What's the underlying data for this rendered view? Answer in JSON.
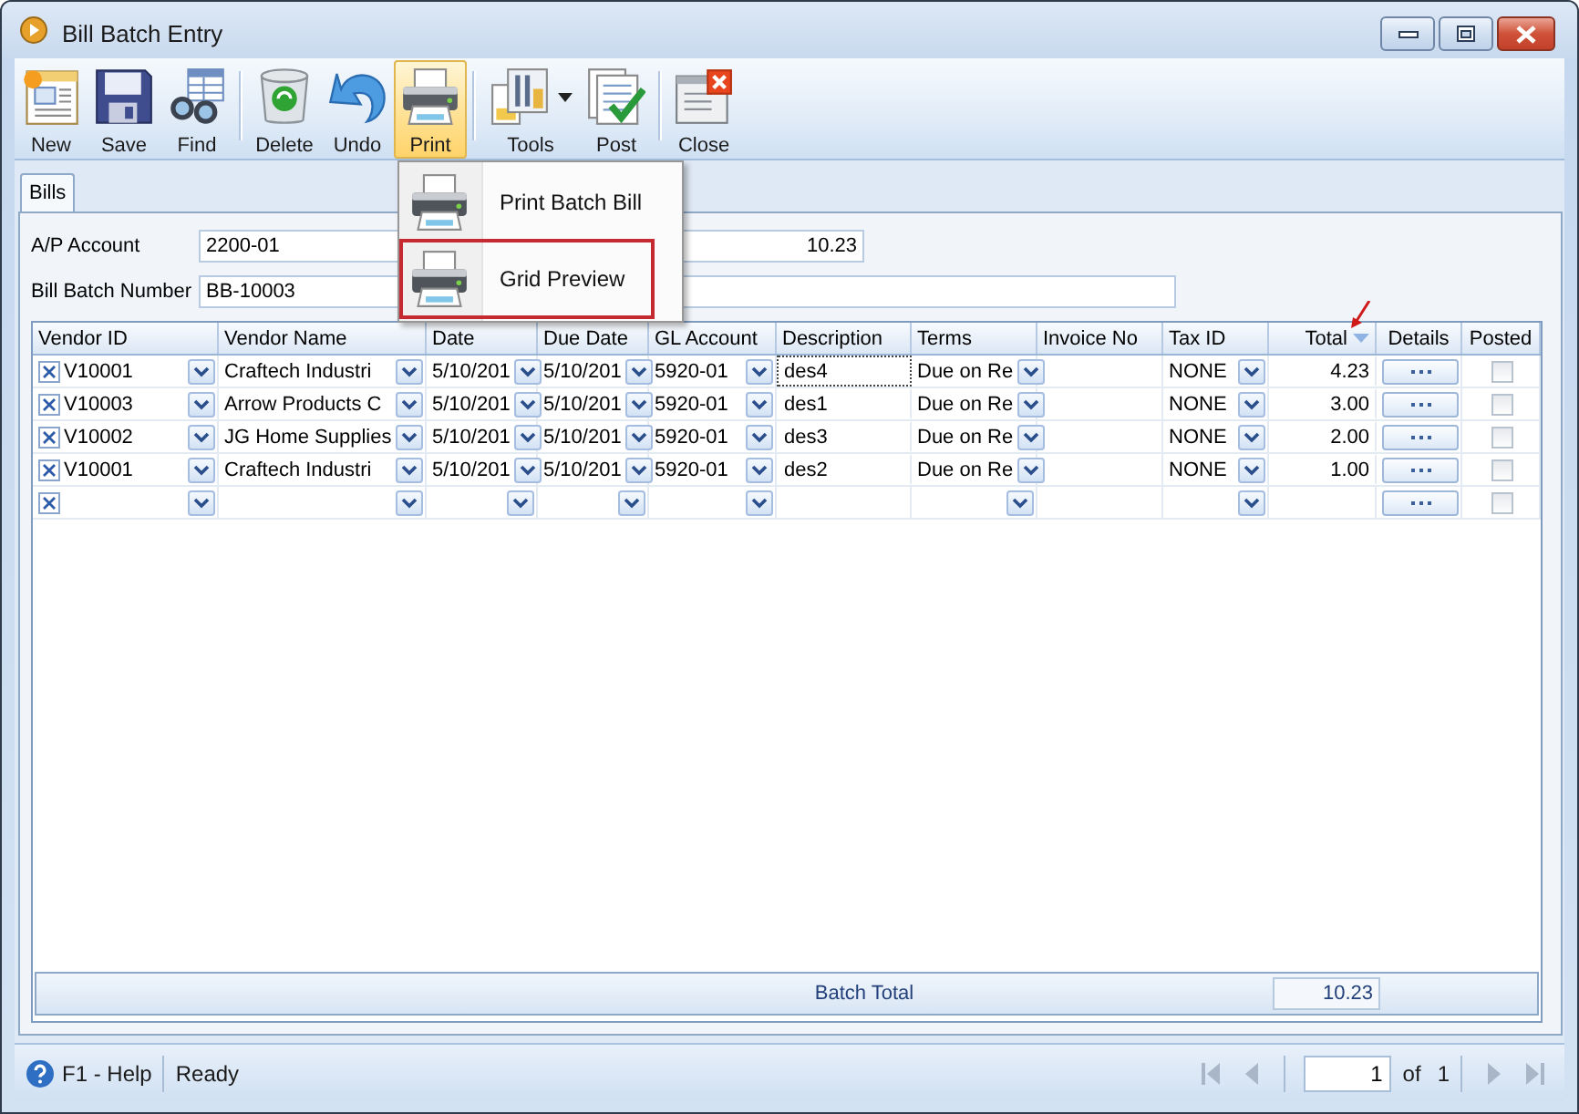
{
  "window": {
    "title": "Bill Batch Entry"
  },
  "toolbar": {
    "groups": [
      [
        {
          "label": "New",
          "kind": "new",
          "pressed": false,
          "has_menu": false
        },
        {
          "label": "Save",
          "kind": "save",
          "pressed": false,
          "has_menu": false
        },
        {
          "label": "Find",
          "kind": "find",
          "pressed": false,
          "has_menu": false
        }
      ],
      [
        {
          "label": "Delete",
          "kind": "delete",
          "pressed": false,
          "has_menu": false
        },
        {
          "label": "Undo",
          "kind": "undo",
          "pressed": false,
          "has_menu": false
        },
        {
          "label": "Print",
          "kind": "print",
          "pressed": true,
          "has_menu": false
        }
      ],
      [
        {
          "label": "Tools",
          "kind": "tools",
          "pressed": false,
          "has_menu": true
        },
        {
          "label": "Post",
          "kind": "post",
          "pressed": false,
          "has_menu": false
        }
      ],
      [
        {
          "label": "Close",
          "kind": "close",
          "pressed": false,
          "has_menu": false
        }
      ]
    ]
  },
  "print_menu": {
    "items": [
      {
        "label": "Print Batch Bill",
        "outlined": false
      },
      {
        "label": "Grid Preview",
        "outlined": true
      }
    ]
  },
  "tabs": [
    {
      "label": "Bills",
      "selected": true
    }
  ],
  "form": {
    "rows": [
      {
        "label": "A/P Account",
        "fields": [
          {
            "value": "2200-01",
            "kind": "text"
          },
          {
            "value": "10.23",
            "kind": "number"
          }
        ]
      },
      {
        "label": "Bill Batch Number",
        "fields": [
          {
            "value": "BB-10003",
            "kind": "text"
          }
        ]
      }
    ]
  },
  "table": {
    "columns": [
      {
        "label": "Vendor ID",
        "kind": "combo",
        "sorted": false,
        "callout": false
      },
      {
        "label": "Vendor Name",
        "kind": "combo",
        "sorted": false,
        "callout": false
      },
      {
        "label": "Date",
        "kind": "combo",
        "sorted": false,
        "callout": false
      },
      {
        "label": "Due Date",
        "kind": "combo",
        "sorted": false,
        "callout": false
      },
      {
        "label": "GL Account",
        "kind": "combo",
        "sorted": false,
        "callout": false
      },
      {
        "label": "Description",
        "kind": "text",
        "sorted": false,
        "callout": false
      },
      {
        "label": "Terms",
        "kind": "combo",
        "sorted": false,
        "callout": false
      },
      {
        "label": "Invoice No",
        "kind": "text",
        "sorted": false,
        "callout": false
      },
      {
        "label": "Tax ID",
        "kind": "combo",
        "sorted": false,
        "callout": false
      },
      {
        "label": "Total",
        "kind": "number",
        "sorted": true,
        "callout": true
      },
      {
        "label": "Details",
        "kind": "button",
        "sorted": false,
        "callout": false
      },
      {
        "label": "Posted",
        "kind": "check",
        "sorted": false,
        "callout": false
      }
    ],
    "rows": [
      {
        "current": true,
        "vendor_id": "V10001",
        "vendor_name": "Craftech Industri",
        "date": "5/10/201",
        "due_date": "5/10/201",
        "gl_account": "5920-01",
        "description": "des4",
        "terms": "Due on Re",
        "tax_id": "NONE",
        "total": "4.23",
        "posted": false
      },
      {
        "current": false,
        "vendor_id": "V10003",
        "vendor_name": "Arrow Products C",
        "date": "5/10/201",
        "due_date": "5/10/201",
        "gl_account": "5920-01",
        "description": "des1",
        "terms": "Due on Re",
        "tax_id": "NONE",
        "total": "3.00",
        "posted": false
      },
      {
        "current": false,
        "vendor_id": "V10002",
        "vendor_name": "JG Home Supplies",
        "date": "5/10/201",
        "due_date": "5/10/201",
        "gl_account": "5920-01",
        "description": "des3",
        "terms": "Due on Re",
        "tax_id": "NONE",
        "total": "2.00",
        "posted": false
      },
      {
        "current": false,
        "vendor_id": "V10001",
        "vendor_name": "Craftech Industri",
        "date": "5/10/201",
        "due_date": "5/10/201",
        "gl_account": "5920-01",
        "description": "des2",
        "terms": "Due on Re",
        "tax_id": "NONE",
        "total": "1.00",
        "posted": false
      },
      {
        "current": false,
        "posted": false
      }
    ],
    "footer": {
      "label": "Batch Total",
      "value": "10.23"
    }
  },
  "status_bar": {
    "help": "F1 - Help",
    "status": "Ready",
    "pager": {
      "page": "1",
      "of": "of",
      "total": "1",
      "buttons": [
        {
          "kind": "first",
          "disabled": true
        },
        {
          "kind": "previous",
          "disabled": true
        },
        {
          "kind": "next",
          "disabled": true
        },
        {
          "kind": "last",
          "disabled": true
        }
      ]
    }
  }
}
